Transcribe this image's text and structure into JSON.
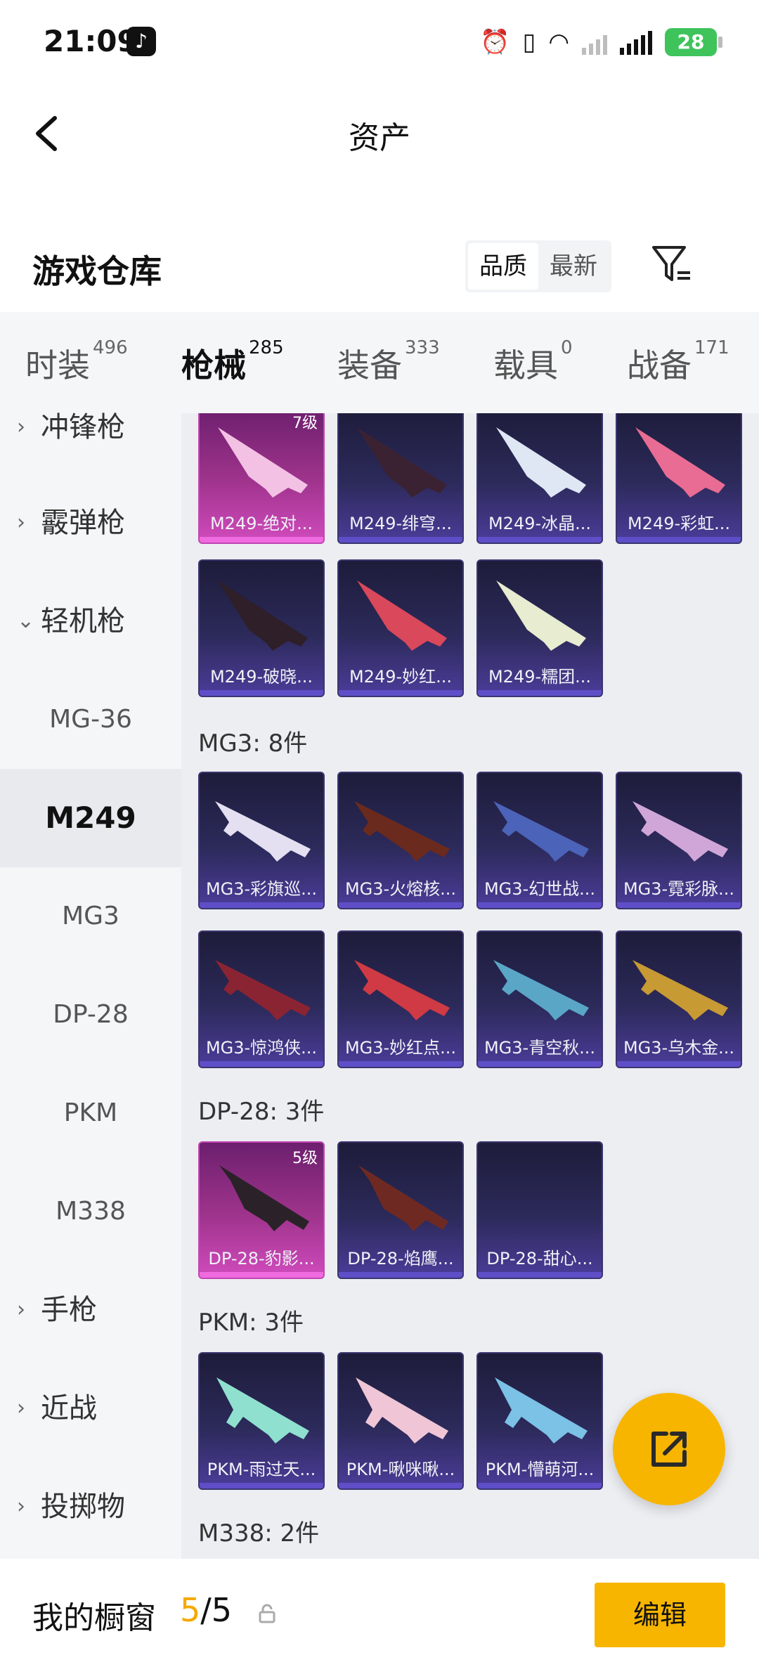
{
  "status": {
    "time": "21:09",
    "battery": "28"
  },
  "nav": {
    "title": "资产"
  },
  "warehouse": {
    "title": "游戏仓库",
    "sort_quality": "品质",
    "sort_newest": "最新"
  },
  "tabs": [
    {
      "label": "时装",
      "count": "496"
    },
    {
      "label": "枪械",
      "count": "285"
    },
    {
      "label": "装备",
      "count": "333"
    },
    {
      "label": "载具",
      "count": "0"
    },
    {
      "label": "战备",
      "count": "171"
    }
  ],
  "sidebar": {
    "groups": [
      "冲锋枪",
      "霰弹枪",
      "轻机枪",
      "手枪",
      "近战",
      "投掷物"
    ],
    "subs": [
      "MG-36",
      "M249",
      "MG3",
      "DP-28",
      "PKM",
      "M338"
    ]
  },
  "sections": {
    "m249": {
      "items": [
        "M249-绝对...",
        "M249-绯穹...",
        "M249-冰晶...",
        "M249-彩虹...",
        "M249-破晓...",
        "M249-妙红...",
        "M249-糯团..."
      ],
      "level_tag": "7级"
    },
    "mg3": {
      "title": "MG3: 8件",
      "items": [
        "MG3-彩旗巡...",
        "MG3-火熔核...",
        "MG3-幻世战...",
        "MG3-霓彩脉...",
        "MG3-惊鸿侠...",
        "MG3-妙红点...",
        "MG3-青空秋...",
        "MG3-乌木金..."
      ]
    },
    "dp28": {
      "title": "DP-28: 3件",
      "items": [
        "DP-28-豹影...",
        "DP-28-焰鹰...",
        "DP-28-甜心..."
      ],
      "level_tag": "5级"
    },
    "pkm": {
      "title": "PKM: 3件",
      "items": [
        "PKM-雨过天...",
        "PKM-啾咪啾...",
        "PKM-懵萌河..."
      ]
    },
    "m338": {
      "title": "M338: 2件"
    }
  },
  "bottom": {
    "label": "我的橱窗",
    "count_current": "5",
    "count_sep": "/",
    "count_total": "5",
    "edit_label": "编辑"
  },
  "colors": {
    "accent": "#f7b500",
    "card_purple": "#2c2a5a",
    "card_pink": "#a0348d"
  }
}
